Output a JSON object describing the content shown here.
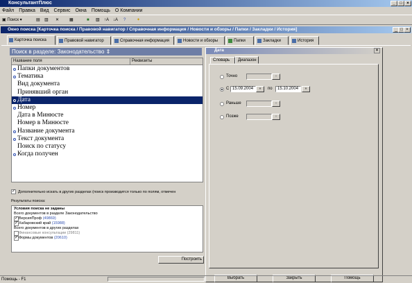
{
  "window": {
    "title": "КонсультантПлюс"
  },
  "menu": [
    "Файл",
    "Правка",
    "Вид",
    "Сервис",
    "Окна",
    "Помощь",
    "О Компании"
  ],
  "toolbar": {
    "search_label": "Поиск",
    "sort_up": "↑А",
    "sort_down": "↓А"
  },
  "inner_title": "Окно поиска [Карточка поиска / Правовой навигатор / Справочная информация / Новости и обзоры / Папки / Закладки / История]",
  "tabs": [
    "Карточка поиска",
    "Правовой навигатор",
    "Справочная информация",
    "Новости и обзоры",
    "Папки",
    "Закладки",
    "История"
  ],
  "search_header": "Поиск в разделе: Законодательство",
  "list": {
    "col_name": "Название поля",
    "col_details": "Реквизиты",
    "items": [
      {
        "label": "Папки документов",
        "dot": true
      },
      {
        "label": "Тематика",
        "dot": true
      },
      {
        "label": "Вид документа",
        "dot": false
      },
      {
        "label": "Принявший орган",
        "dot": false
      },
      {
        "label": "Дата",
        "dot": true
      },
      {
        "label": "Номер",
        "dot": true
      },
      {
        "label": "Дата в Минюсте",
        "dot": false
      },
      {
        "label": "Номер в Минюсте",
        "dot": false
      },
      {
        "label": "Название документа",
        "dot": true
      },
      {
        "label": "Текст документа",
        "dot": true
      },
      {
        "label": "Поиск по статусу",
        "dot": false
      },
      {
        "label": "Когда получен",
        "dot": true
      }
    ],
    "selected": 4
  },
  "extra_search": "Дополнительно искать в других разделах (поиск производится только по полям, отмечен",
  "results": {
    "label": "Результаты поиска:",
    "title": "Условия поиска не заданы",
    "total_laws": "Всего документов в разделе Законодательство",
    "items": [
      {
        "name": "ВерсияПроф",
        "count": "(49869)",
        "checked": true
      },
      {
        "name": "Хабаровский край",
        "count": "(15988)",
        "checked": true
      }
    ],
    "total_other": "Всего документов в других разделах",
    "items2": [
      {
        "name": "Финансовые консультации",
        "count": "(29811)",
        "checked": false
      },
      {
        "name": "Формы документов",
        "count": "(20610)",
        "checked": true
      }
    ]
  },
  "build_button": "Построить",
  "dialog": {
    "title": "Дата",
    "tabs": [
      "Словарь",
      "Диапазон"
    ],
    "options": [
      {
        "label": "Точно",
        "checked": false
      },
      {
        "label": "С",
        "checked": true
      },
      {
        "label": "Раньше",
        "checked": false
      },
      {
        "label": "Позже",
        "checked": false
      }
    ],
    "date_from": "15.09.2004",
    "date_to_label": "по",
    "date_to": "15.10.2004",
    "buttons": [
      "Выбрать",
      "Закрыть",
      "Помощь"
    ]
  },
  "status": "Помощь - F1"
}
